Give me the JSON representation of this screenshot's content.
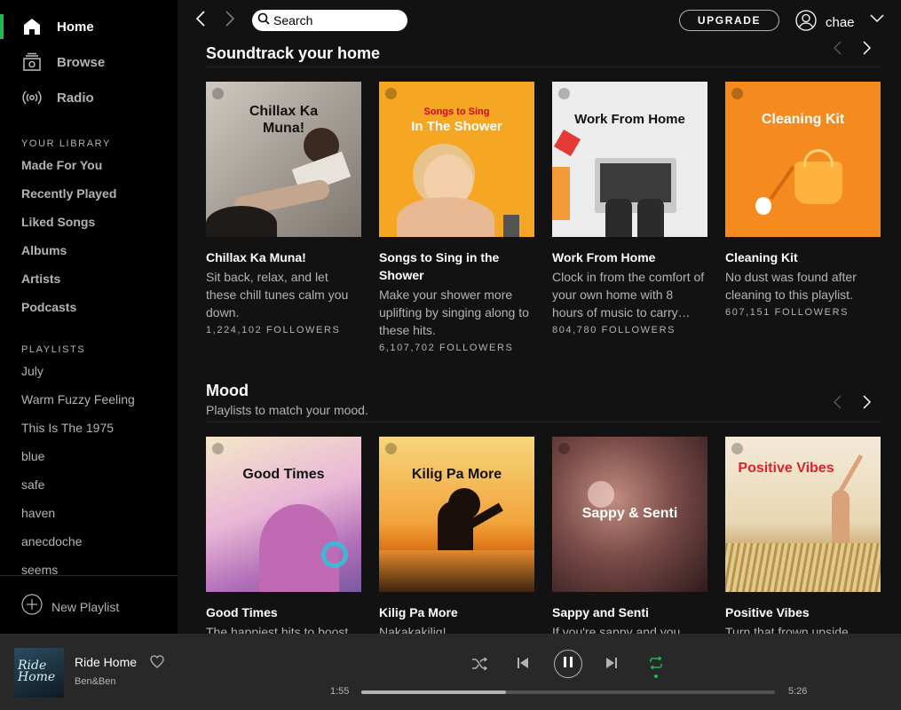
{
  "sidebar": {
    "nav": [
      {
        "label": "Home",
        "icon": "home-icon",
        "active": true
      },
      {
        "label": "Browse",
        "icon": "browse-icon"
      },
      {
        "label": "Radio",
        "icon": "radio-icon"
      }
    ],
    "library_title": "YOUR LIBRARY",
    "library": [
      "Made For You",
      "Recently Played",
      "Liked Songs",
      "Albums",
      "Artists",
      "Podcasts"
    ],
    "playlists_title": "PLAYLISTS",
    "playlists": [
      "July",
      "Warm Fuzzy Feeling",
      "This Is The 1975",
      "blue",
      "safe",
      "haven",
      "anecdoche",
      "seems"
    ],
    "new_playlist": "New Playlist"
  },
  "topbar": {
    "search_placeholder": "Search",
    "upgrade": "UPGRADE",
    "username": "chae"
  },
  "shelves": [
    {
      "title": "Soundtrack your home",
      "subtitle": "",
      "cards": [
        {
          "cover_text": "Chillax Ka Muna!",
          "title": "Chillax Ka Muna!",
          "desc": "Sit back, relax, and let these chill tunes calm you down.",
          "followers": "1,224,102 FOLLOWERS"
        },
        {
          "cover_small": "Songs to Sing",
          "cover_text": "In The Shower",
          "title": "Songs to Sing in the Shower",
          "desc": "Make your shower more uplifting by singing along to these hits.",
          "followers": "6,107,702 FOLLOWERS"
        },
        {
          "cover_text": "Work From Home",
          "title": "Work From Home",
          "desc": "Clock in from the comfort of your own home with 8 hours of music to carry…",
          "followers": "804,780 FOLLOWERS"
        },
        {
          "cover_text": "Cleaning Kit",
          "title": "Cleaning Kit",
          "desc": "No dust was found after cleaning to this playlist.",
          "followers": "607,151 FOLLOWERS"
        }
      ]
    },
    {
      "title": "Mood",
      "subtitle": "Playlists to match your mood.",
      "cards": [
        {
          "cover_text": "Good Times",
          "title": "Good Times",
          "desc": "The happiest hits to boost"
        },
        {
          "cover_text": "Kilig Pa More",
          "title": "Kilig Pa More",
          "desc": "Nakakakilig!"
        },
        {
          "cover_text": "Sappy & Senti",
          "title": "Sappy and Senti",
          "desc": "If you're sappy and you"
        },
        {
          "cover_text": "Positive Vibes",
          "title": "Positive Vibes",
          "desc": "Turn that frown upside"
        }
      ]
    }
  ],
  "player": {
    "art_text": "Ride Home",
    "title": "Ride Home",
    "artist": "Ben&Ben",
    "elapsed": "1:55",
    "duration": "5:26",
    "progress_fraction": 0.35,
    "accent": "#1db954"
  }
}
